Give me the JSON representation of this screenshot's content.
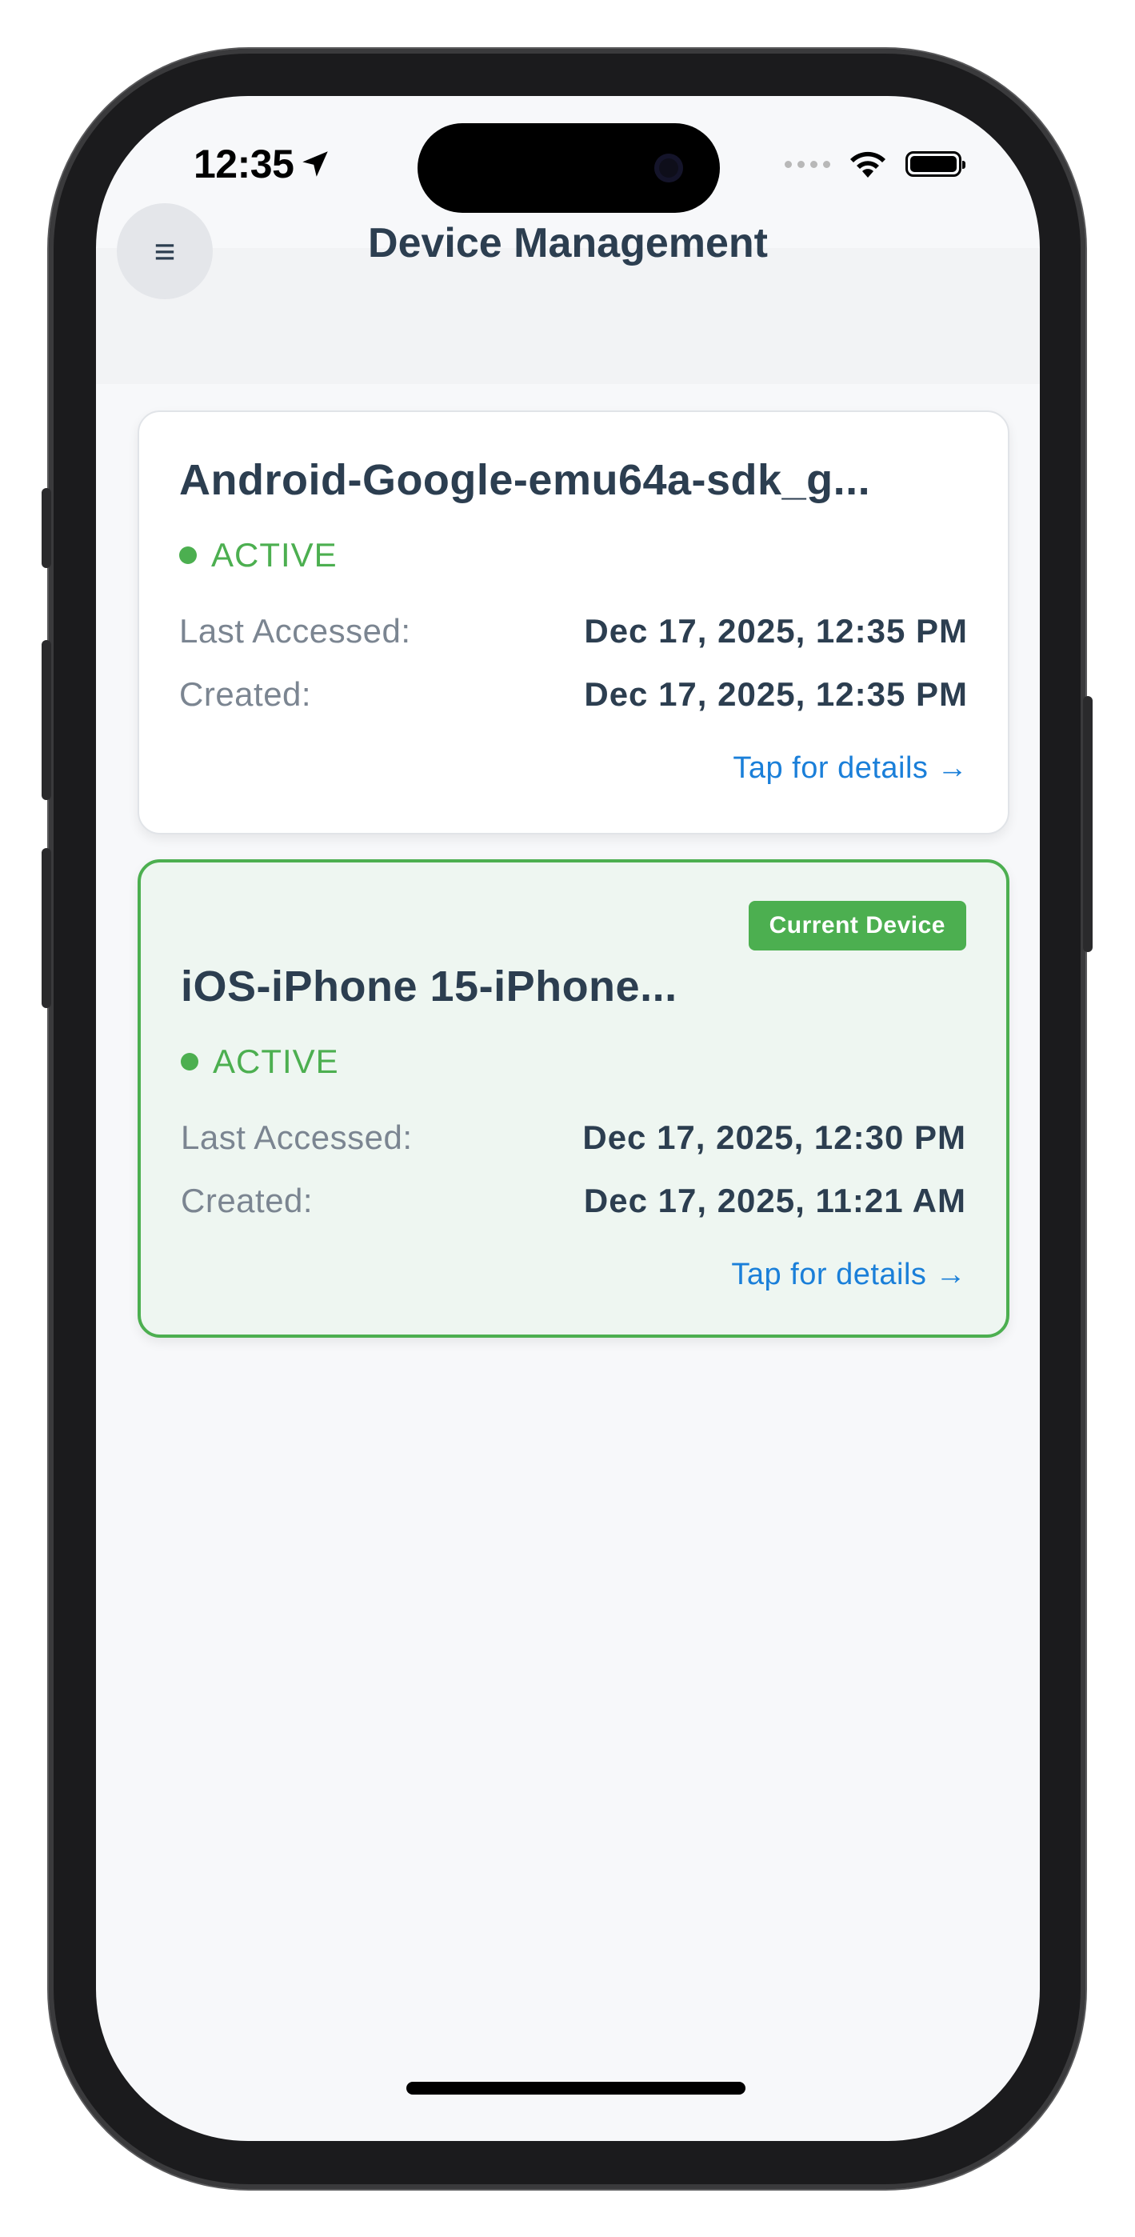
{
  "status_bar": {
    "time": "12:35"
  },
  "header": {
    "title": "Device Management",
    "menu_icon": "≡"
  },
  "devices": [
    {
      "name": "Android-Google-emu64a-sdk_g...",
      "status": "ACTIVE",
      "last_accessed_label": "Last Accessed:",
      "last_accessed": "Dec 17, 2025, 12:35 PM",
      "created_label": "Created:",
      "created": "Dec 17, 2025, 12:35 PM",
      "details_link": "Tap for details →"
    },
    {
      "name": "iOS-iPhone 15-iPhone...",
      "badge": "Current Device",
      "status": "ACTIVE",
      "last_accessed_label": "Last Accessed:",
      "last_accessed": "Dec 17, 2025, 12:30 PM",
      "created_label": "Created:",
      "created": "Dec 17, 2025, 11:21 AM",
      "details_link": "Tap for details →"
    }
  ],
  "colors": {
    "accent_green": "#4caf50",
    "link_blue": "#1a7fd9",
    "text_dark": "#2c3e50"
  }
}
